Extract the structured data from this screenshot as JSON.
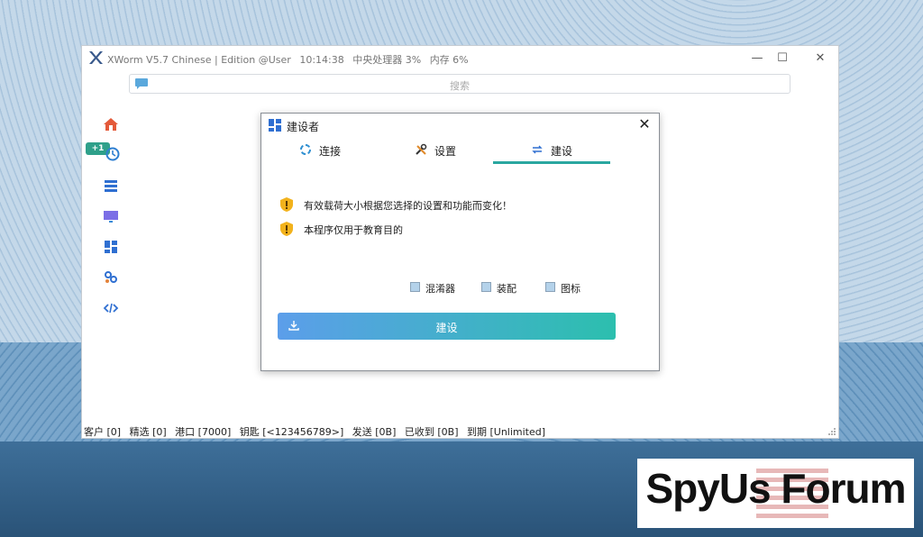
{
  "window": {
    "title_parts": [
      "XWorm V5.7 Chinese | Edition @User",
      "10:14:38",
      "中央处理器 3%",
      "内存 6%"
    ],
    "controls": {
      "minimize": "—",
      "maximize": "☐",
      "close": "✕"
    }
  },
  "search": {
    "placeholder": "搜索"
  },
  "sidebar": {
    "badge": "+1",
    "items": [
      {
        "icon": "home-icon"
      },
      {
        "icon": "history-icon"
      },
      {
        "icon": "list-icon"
      },
      {
        "icon": "monitor-icon"
      },
      {
        "icon": "dashboard-icon"
      },
      {
        "icon": "plugins-icon"
      },
      {
        "icon": "code-icon"
      }
    ]
  },
  "statusbar": [
    "客户 [0]",
    "精选 [0]",
    "港口 [7000]",
    "钥匙 [<123456789>]",
    "发送 [0B]",
    "已收到 [0B]",
    "到期 [Unlimited]"
  ],
  "dialog": {
    "title": "建设者",
    "close": "✕",
    "tabs": [
      {
        "label": "连接",
        "icon": "connect-icon",
        "active": false
      },
      {
        "label": "设置",
        "icon": "tools-icon",
        "active": false
      },
      {
        "label": "建设",
        "icon": "build-icon",
        "active": true
      }
    ],
    "notices": [
      "有效载荷大小根据您选择的设置和功能而变化！",
      "本程序仅用于教育目的"
    ],
    "options": [
      {
        "label": "混淆器",
        "checked": false
      },
      {
        "label": "装配",
        "checked": false
      },
      {
        "label": "图标",
        "checked": false
      }
    ],
    "build_button": "建设",
    "accent": "#2aa7a0"
  },
  "watermark": {
    "text": "SpyUs Forum"
  }
}
